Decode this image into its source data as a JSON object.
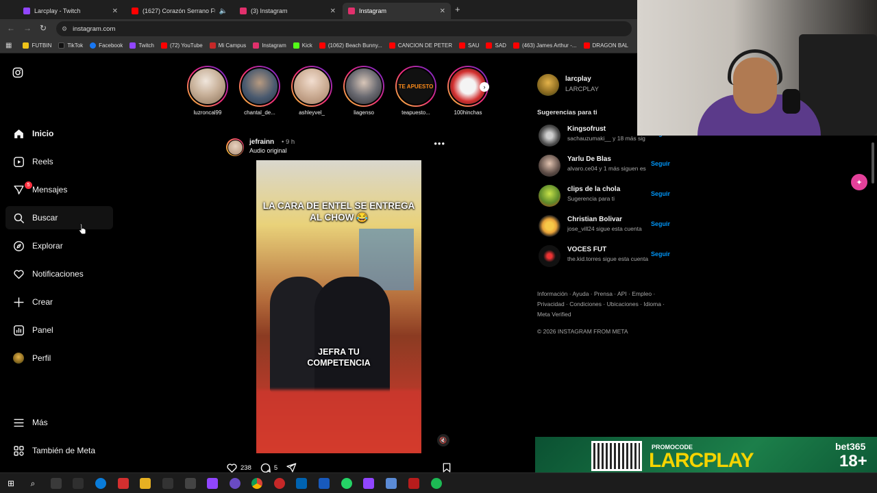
{
  "browser": {
    "tabs": [
      {
        "title": "Larcplay - Twitch",
        "color": "#9146ff",
        "active": false
      },
      {
        "title": "(1627) Corazón Serrano Ft",
        "color": "#ff0000",
        "active": false
      },
      {
        "title": "(3) Instagram",
        "color": "#e1306c",
        "active": false
      },
      {
        "title": "Instagram",
        "color": "#e1306c",
        "active": true
      }
    ],
    "url": "instagram.com",
    "bookmarks": [
      {
        "label": "FUTBIN",
        "color": "#f0c419"
      },
      {
        "label": "TikTok",
        "color": "#111111"
      },
      {
        "label": "Facebook",
        "color": "#1877f2"
      },
      {
        "label": "Twitch",
        "color": "#9146ff"
      },
      {
        "label": "(72) YouTube",
        "color": "#ff0000"
      },
      {
        "label": "Mi Campus",
        "color": "#c62828"
      },
      {
        "label": "Instagram",
        "color": "#e1306c"
      },
      {
        "label": "Kick",
        "color": "#53fc18"
      },
      {
        "label": "(1062) Beach Bunny...",
        "color": "#ff0000"
      },
      {
        "label": "CANCION DE PETER",
        "color": "#ff0000"
      },
      {
        "label": "SAU",
        "color": "#ff0000"
      },
      {
        "label": "SAD",
        "color": "#ff0000"
      },
      {
        "label": "(463) James Arthur -...",
        "color": "#ff0000"
      },
      {
        "label": "DRAGON BAL",
        "color": "#ff0000"
      }
    ]
  },
  "sidebar": {
    "items": [
      {
        "label": "Inicio",
        "icon": "home-icon"
      },
      {
        "label": "Reels",
        "icon": "reels-icon"
      },
      {
        "label": "Mensajes",
        "icon": "messenger-icon",
        "badge": "5"
      },
      {
        "label": "Buscar",
        "icon": "search-icon"
      },
      {
        "label": "Explorar",
        "icon": "compass-icon"
      },
      {
        "label": "Notificaciones",
        "icon": "heart-icon"
      },
      {
        "label": "Crear",
        "icon": "plus-icon"
      },
      {
        "label": "Panel",
        "icon": "chart-icon"
      },
      {
        "label": "Perfil",
        "icon": "avatar"
      }
    ],
    "more": "Más",
    "meta": "También de Meta"
  },
  "stories": [
    {
      "name": "luzroncal99"
    },
    {
      "name": "chantal_de..."
    },
    {
      "name": "ashleyvel_"
    },
    {
      "name": "liagenso"
    },
    {
      "name": "teapuesto..."
    },
    {
      "name": "100hinchas"
    }
  ],
  "post": {
    "author": "jefrainn",
    "time": "• 9 h",
    "audio": "Audio original",
    "caption_top": "LA CARA DE ENTEL SE ENTREGA AL CHOW 😂",
    "caption_bottom": "JEFRA TU COMPETENCIA",
    "likes": "238",
    "comments": "5"
  },
  "profile": {
    "username": "larcplay",
    "fullname": "LARCPLAY"
  },
  "suggestions": {
    "heading": "Sugerencias para ti",
    "follow": "Seguir",
    "items": [
      {
        "name": "Kingsofrust",
        "sub": "sachauzumaki__ y 18 más sig"
      },
      {
        "name": "Yarlu De Blas",
        "sub": "alvaro.ce04 y 1 más siguen es"
      },
      {
        "name": "clips de la chola",
        "sub": "Sugerencia para ti"
      },
      {
        "name": "Christian Bolivar",
        "sub": "jose_vill24 sigue esta cuenta"
      },
      {
        "name": "VOCES FUT",
        "sub": "the.kid.torres sigue esta cuenta"
      }
    ]
  },
  "footer": {
    "links1": "Información · Ayuda · Prensa · API · Empleo ·",
    "links2": "Privacidad · Condiciones · Ubicaciones · Idioma ·",
    "links3": "Meta Verified",
    "copyright": "© 2026 INSTAGRAM FROM META"
  },
  "promo": {
    "label": "PROMOCODE",
    "code": "LARCPLAY",
    "brand": "bet365",
    "age": "18+"
  }
}
